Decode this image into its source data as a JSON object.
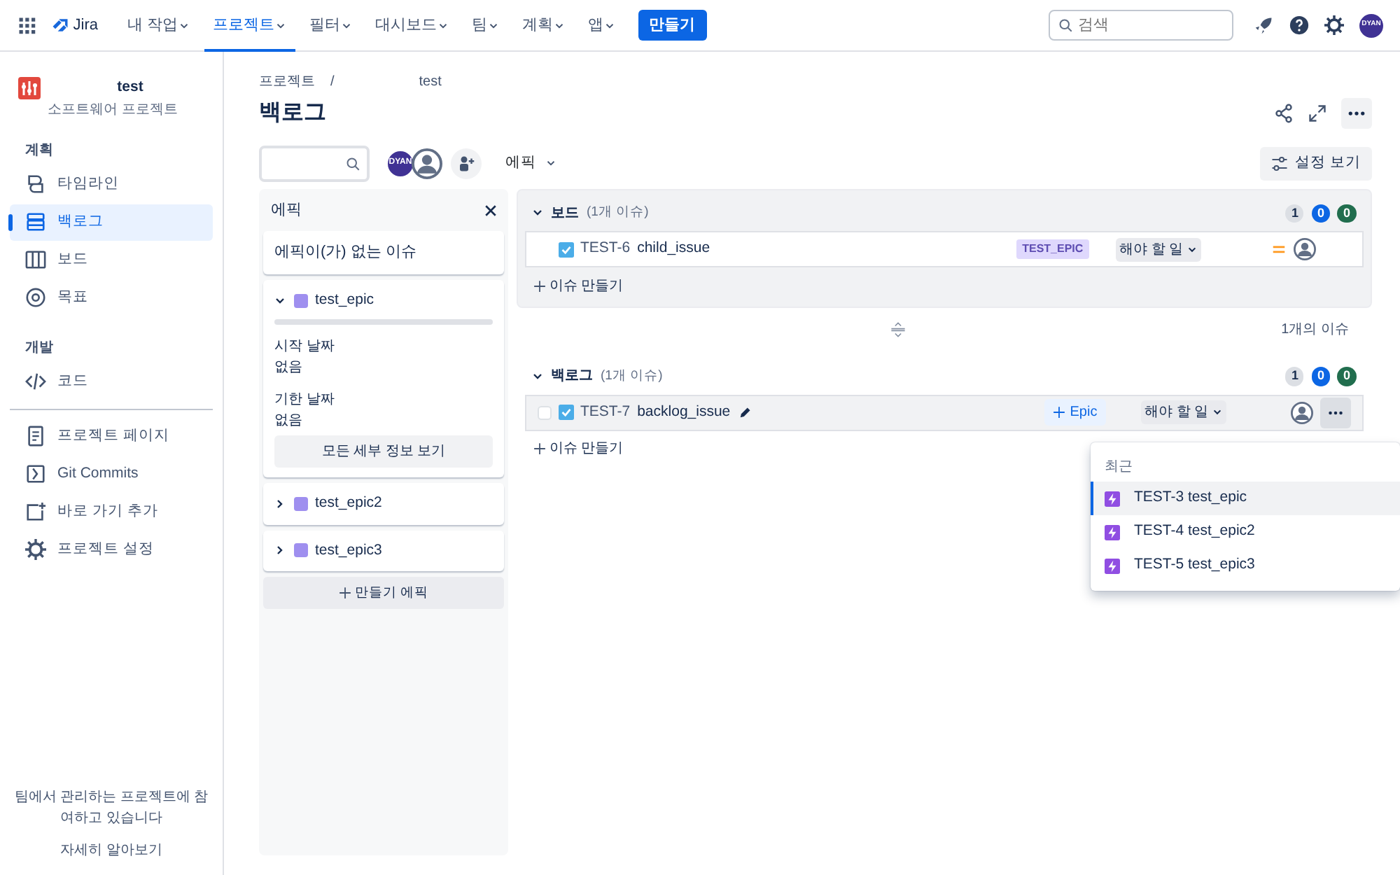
{
  "topnav": {
    "product": "Jira",
    "menus": [
      {
        "label": "내 작업",
        "selected": false
      },
      {
        "label": "프로젝트",
        "selected": true
      },
      {
        "label": "필터",
        "selected": false
      },
      {
        "label": "대시보드",
        "selected": false
      },
      {
        "label": "팀",
        "selected": false
      },
      {
        "label": "계획",
        "selected": false
      },
      {
        "label": "앱",
        "selected": false
      }
    ],
    "create_button": "만들기",
    "search": {
      "placeholder": "검색"
    },
    "avatar": "DYAN"
  },
  "sidebar": {
    "project": {
      "name": "test",
      "type": "소프트웨어 프로젝트"
    },
    "sections": [
      {
        "heading": "계획",
        "items": [
          {
            "label": "타임라인",
            "selected": false
          },
          {
            "label": "백로그",
            "selected": true
          },
          {
            "label": "보드",
            "selected": false
          },
          {
            "label": "목표",
            "selected": false
          }
        ]
      },
      {
        "heading": "개발",
        "items": [
          {
            "label": "코드",
            "selected": false
          }
        ]
      },
      {
        "items": [
          {
            "label": "프로젝트 페이지",
            "selected": false
          },
          {
            "label": "Git Commits",
            "selected": false
          },
          {
            "label": "바로 가기 추가",
            "selected": false
          },
          {
            "label": "프로젝트 설정",
            "selected": false
          }
        ]
      }
    ],
    "footer": {
      "text": "팀에서 관리하는 프로젝트에 참여하고 있습니다",
      "link": "자세히 알아보기"
    }
  },
  "breadcrumb": [
    "프로젝트",
    "test"
  ],
  "breadcrumb_separator": "/",
  "title": "백로그",
  "toolbar": {
    "avatars": [
      "DYAN"
    ],
    "filter": "에픽",
    "settings_button": "설정 보기"
  },
  "epic_panel": {
    "title": "에픽",
    "no_epic": "에픽이(가) 없는 이슈",
    "epics": [
      {
        "name": "test_epic",
        "color": "#9f8fef",
        "expanded": true,
        "level": 0,
        "fields": [
          {
            "label": "시작 날짜",
            "value": "없음"
          },
          {
            "label": "기한 날짜",
            "value": "없음"
          }
        ],
        "details_button": "모든 세부 정보 보기"
      },
      {
        "name": "test_epic2",
        "color": "#9f8fef",
        "expanded": false
      },
      {
        "name": "test_epic3",
        "color": "#9f8fef",
        "expanded": false
      }
    ],
    "create_button": "만들기 에픽"
  },
  "sprints": [
    {
      "name": "보드",
      "count": "(1개 이슈)",
      "boxed": true,
      "counters": [
        {
          "value": "1",
          "color": "#dcdfe4"
        },
        {
          "value": "0",
          "color": "#0c66e4"
        },
        {
          "value": "0",
          "color": "#216e4e"
        }
      ],
      "issues": [
        {
          "key": "TEST-6",
          "summary": "child_issue",
          "hovered": false,
          "epic": "TEST_EPIC",
          "status": "해야 할 일"
        }
      ],
      "create": "이슈 만들기"
    },
    {
      "name": "백로그",
      "count": "(1개 이슈)",
      "boxed": false,
      "note": "1개의 이슈",
      "counters": [
        {
          "value": "1",
          "color": "#dcdfe4"
        },
        {
          "value": "0",
          "color": "#0c66e4"
        },
        {
          "value": "0",
          "color": "#216e4e"
        }
      ],
      "issues": [
        {
          "key": "TEST-7",
          "summary": "backlog_issue",
          "hovered": true,
          "add_epic": "Epic",
          "status": "해야 할 일"
        }
      ],
      "create": "이슈 만들기"
    }
  ],
  "epic_menu": {
    "heading": "최근",
    "items": [
      {
        "key": "TEST-3",
        "summary": "test_epic",
        "selected": true
      },
      {
        "key": "TEST-4",
        "summary": "test_epic2",
        "selected": false
      },
      {
        "key": "TEST-5",
        "summary": "test_epic3",
        "selected": false
      }
    ]
  }
}
